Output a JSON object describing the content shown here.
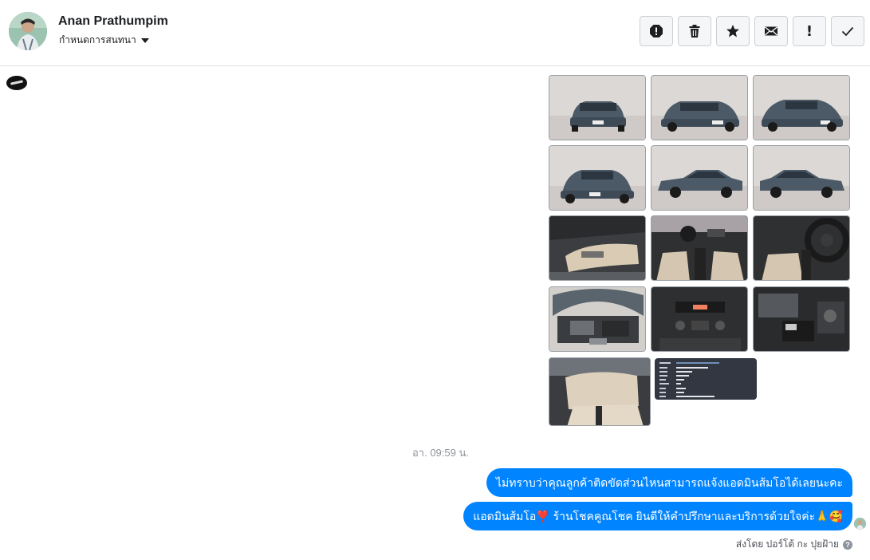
{
  "header": {
    "contact_name": "Anan Prathumpim",
    "assign_label": "กำหนดการสนทนา",
    "actions": [
      {
        "name": "mark-spam-button",
        "icon": "alert-circle-icon"
      },
      {
        "name": "delete-button",
        "icon": "trash-icon"
      },
      {
        "name": "star-button",
        "icon": "star-icon"
      },
      {
        "name": "mark-unread-button",
        "icon": "envelope-icon"
      },
      {
        "name": "follow-up-button",
        "icon": "exclamation-icon"
      },
      {
        "name": "mark-done-button",
        "icon": "check-icon"
      }
    ]
  },
  "conversation": {
    "photo_count": 14,
    "timestamp": "อา. 09:59 น.",
    "messages": [
      {
        "text": "ไม่ทราบว่าคุณลูกค้าติดขัดส่วนไหนสามารถแจ้งแอดมินส้มโอได้เลยนะคะ"
      },
      {
        "text": "แอดมินส้มโอ❣️ ร้านโชคคูณโชค ยินดีให้คำปรึกษาและบริการด้วยใจค่ะ🙏🥰"
      }
    ],
    "sent_by": "ส่งโดย ปอร์โต้ กะ ปุยฝ้าย"
  },
  "colors": {
    "bubble": "#0084ff",
    "button_bg": "#f5f6f7",
    "muted_text": "#90949c"
  }
}
